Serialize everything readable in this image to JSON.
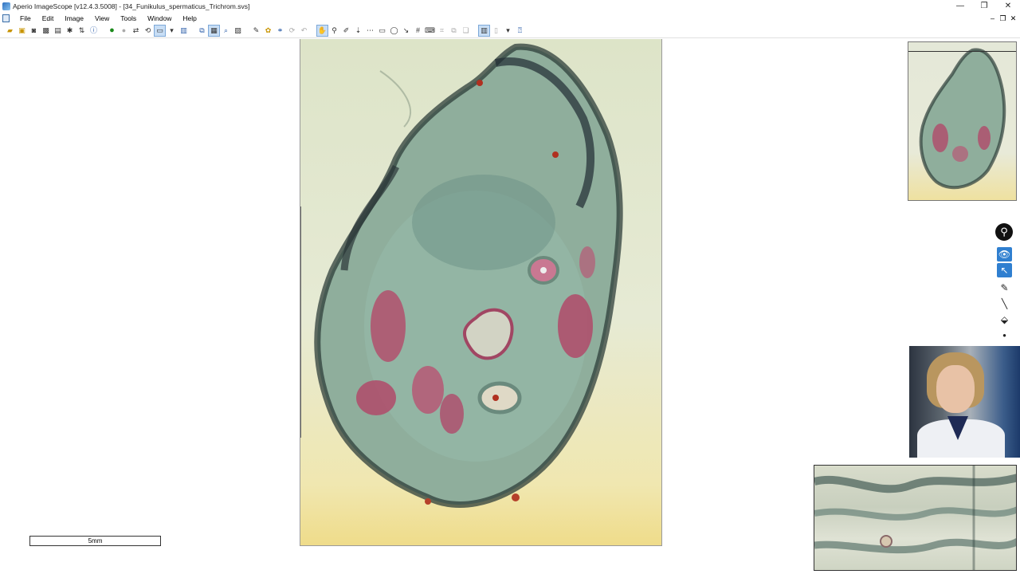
{
  "window": {
    "title": "Aperio ImageScope [v12.4.3.5008] - [34_Funikulus_spermaticus_Trichrom.svs]",
    "controls": {
      "minimize": "—",
      "restore": "❐",
      "close": "✕"
    }
  },
  "menubar": {
    "items": [
      "File",
      "Edit",
      "Image",
      "View",
      "Tools",
      "Window",
      "Help"
    ],
    "mdi_controls": {
      "minimize": "–",
      "restore": "❐",
      "close": "✕"
    }
  },
  "toolbar": {
    "icons": [
      "open-folder-icon",
      "open-image-icon",
      "camera-icon",
      "capture-icon",
      "print-icon",
      "settings-icon",
      "image-info-icon",
      "info-icon",
      "back-icon",
      "forward-icon",
      "pan-icon",
      "rotate-icon",
      "zoom-select-icon",
      "fit-icon",
      "overview-icon",
      "magnifier-icon",
      "detail-view-icon",
      "annotations-icon",
      "heatmap-icon",
      "sync-icon",
      "link-icon",
      "refresh-icon",
      "hand-tool-icon",
      "zoom-tool-icon",
      "pen-tool-icon",
      "arrow-tool-icon",
      "ruler-tool-icon",
      "rectangle-tool-icon",
      "ellipse-tool-icon",
      "line-tool-icon",
      "grid-icon",
      "keyboard-icon",
      "tile-icon",
      "compare-icon",
      "window-icon",
      "layout-icon",
      "dropdown-icon",
      "help-icon"
    ]
  },
  "viewer": {
    "scalebar_label": "5mm",
    "thumbnail_label": "thumbnail",
    "detail_label": "detail-view"
  },
  "palette": {
    "tools": [
      "view-tool-icon",
      "select-tool-icon",
      "pen-annotate-icon",
      "line-annotate-icon",
      "eraser-icon",
      "dot-icon"
    ],
    "active_color": "#2f7fd0"
  },
  "colors": {
    "stain_green": "#4f8a72",
    "stain_red": "#b04a6a",
    "slide_bg": "#e4e8d2"
  }
}
